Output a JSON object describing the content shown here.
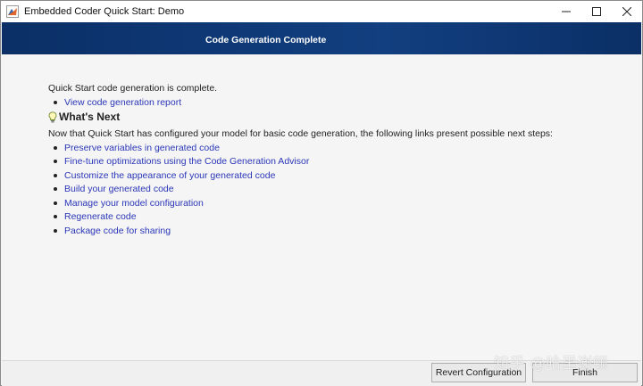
{
  "window": {
    "title": "Embedded Coder Quick Start: Demo"
  },
  "banner": {
    "title": "Code Generation Complete"
  },
  "content": {
    "complete_text": "Quick Start code generation is complete.",
    "report_link": "View code generation report",
    "whats_next_title": "What's Next",
    "intro_text": "Now that Quick Start has configured your model for basic code generation, the following links present possible next steps:",
    "steps": [
      "Preserve variables in generated code",
      "Fine-tune optimizations using the Code Generation Advisor",
      "Customize the appearance of your generated code",
      "Build your generated code",
      "Manage your model configuration",
      "Regenerate code",
      "Package code for sharing"
    ]
  },
  "footer": {
    "revert_label": "Revert Configuration",
    "finish_label": "Finish"
  },
  "watermark": {
    "text": "知乎 @哈里谢顿"
  },
  "colors": {
    "banner": "#0f3a78",
    "link": "#2a36b8",
    "background": "#f5f5f5"
  },
  "icons": {
    "app": "matlab-app-icon",
    "whats_next": "lightbulb-icon"
  }
}
